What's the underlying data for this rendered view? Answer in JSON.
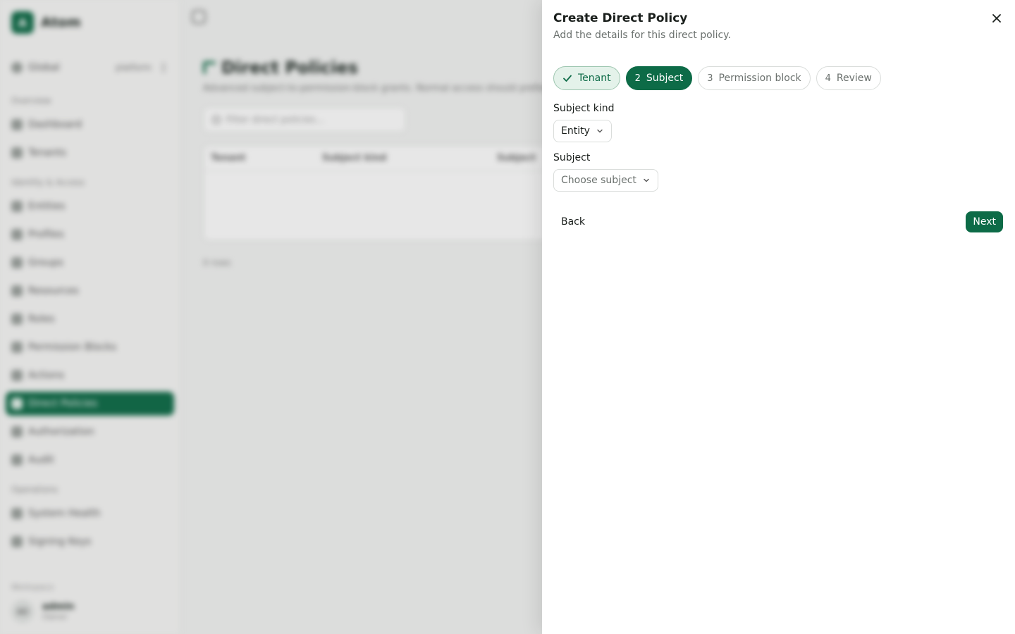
{
  "background": {
    "brand": {
      "logo_letter": "A",
      "name": "Atom"
    },
    "scope": {
      "label": "Global",
      "tenant": "platform"
    },
    "nav_groups": [
      {
        "title": "Overview",
        "items": [
          "Dashboard",
          "Tenants"
        ]
      },
      {
        "title": "Identity & Access",
        "items": [
          "Entities",
          "Profiles",
          "Groups",
          "Resources",
          "Roles",
          "Permission Blocks",
          "Actions",
          "Direct Policies",
          "Authorization",
          "Audit"
        ]
      },
      {
        "title": "Operations",
        "items": [
          "System Health",
          "Signing Keys"
        ]
      }
    ],
    "workspace_label": "Workspace",
    "user": {
      "initials": "AD",
      "name": "admin",
      "role": "Owner"
    },
    "page": {
      "title": "Direct Policies",
      "subtitle": "Advanced subject-to-permission-block grants. Normal access should prefer roles.",
      "filter_placeholder": "Filter direct policies...",
      "columns": [
        "Tenant",
        "Subject kind",
        "Subject"
      ],
      "count": "0 rows"
    }
  },
  "sheet": {
    "title": "Create Direct Policy",
    "description": "Add the details for this direct policy.",
    "close_icon": "close-icon",
    "steps": [
      {
        "number": "1",
        "label": "Tenant",
        "state": "done"
      },
      {
        "number": "2",
        "label": "Subject",
        "state": "current"
      },
      {
        "number": "3",
        "label": "Permission block",
        "state": "upcoming"
      },
      {
        "number": "4",
        "label": "Review",
        "state": "upcoming"
      }
    ],
    "subject_kind": {
      "label": "Subject kind",
      "value": "Entity"
    },
    "subject": {
      "label": "Subject",
      "placeholder": "Choose subject"
    },
    "back_label": "Back",
    "next_label": "Next",
    "colors": {
      "primary": "#0d6b47",
      "primary_soft": "#e4f2ea",
      "muted_text": "#6b716e"
    }
  }
}
